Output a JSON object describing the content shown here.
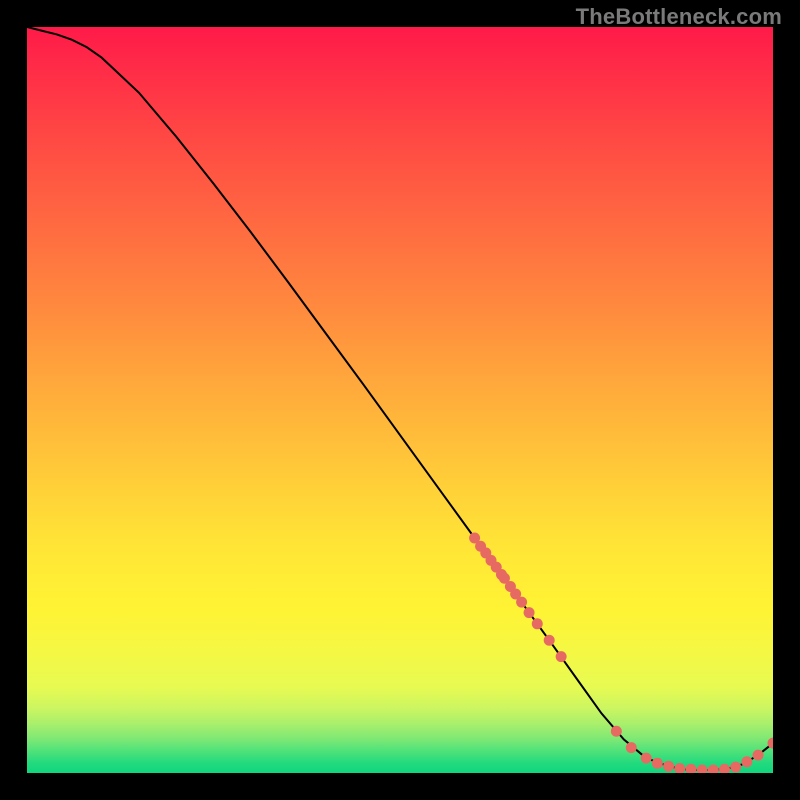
{
  "watermark": "TheBottleneck.com",
  "colors": {
    "gradient_top": "#ff1f4a",
    "gradient_mid": "#ffd93b",
    "gradient_bottom": "#15e27e",
    "line": "#000000",
    "marker": "#e76a62",
    "background": "#000000"
  },
  "chart_data": {
    "type": "line",
    "title": "",
    "xlabel": "",
    "ylabel": "",
    "xlim": [
      0,
      100
    ],
    "ylim": [
      0,
      100
    ],
    "grid": false,
    "legend": false,
    "series": [
      {
        "name": "curve",
        "x": [
          0,
          2,
          4,
          6,
          8,
          10,
          15,
          20,
          25,
          30,
          35,
          40,
          45,
          50,
          55,
          60,
          62,
          66,
          70,
          74,
          77,
          80,
          83,
          86,
          88,
          90,
          92,
          94,
          96,
          98,
          100
        ],
        "y": [
          100,
          99.5,
          99.0,
          98.3,
          97.3,
          95.9,
          91.2,
          85.3,
          79.0,
          72.5,
          65.8,
          59.0,
          52.2,
          45.3,
          38.4,
          31.5,
          28.8,
          23.3,
          17.8,
          12.2,
          8.0,
          4.5,
          2.0,
          0.9,
          0.5,
          0.4,
          0.4,
          0.6,
          1.2,
          2.4,
          4.0
        ]
      }
    ],
    "marker_clusters": [
      {
        "name": "upper-slope-cluster",
        "approx_x_range": [
          60,
          72
        ],
        "approx_y_range": [
          14,
          32
        ],
        "count": 14
      },
      {
        "name": "valley-cluster",
        "approx_x_range": [
          80,
          100
        ],
        "approx_y_range": [
          0,
          5
        ],
        "count": 14
      }
    ],
    "markers": [
      {
        "x": 60.0,
        "y": 31.5
      },
      {
        "x": 60.8,
        "y": 30.4
      },
      {
        "x": 61.5,
        "y": 29.5
      },
      {
        "x": 62.2,
        "y": 28.5
      },
      {
        "x": 62.9,
        "y": 27.6
      },
      {
        "x": 63.6,
        "y": 26.6
      },
      {
        "x": 64.0,
        "y": 26.1
      },
      {
        "x": 64.8,
        "y": 25.0
      },
      {
        "x": 65.5,
        "y": 24.0
      },
      {
        "x": 66.3,
        "y": 22.9
      },
      {
        "x": 67.3,
        "y": 21.5
      },
      {
        "x": 68.4,
        "y": 20.0
      },
      {
        "x": 70.0,
        "y": 17.8
      },
      {
        "x": 71.6,
        "y": 15.6
      },
      {
        "x": 79.0,
        "y": 5.6
      },
      {
        "x": 81.0,
        "y": 3.4
      },
      {
        "x": 83.0,
        "y": 2.0
      },
      {
        "x": 84.5,
        "y": 1.3
      },
      {
        "x": 86.0,
        "y": 0.9
      },
      {
        "x": 87.5,
        "y": 0.6
      },
      {
        "x": 89.0,
        "y": 0.5
      },
      {
        "x": 90.5,
        "y": 0.4
      },
      {
        "x": 92.0,
        "y": 0.4
      },
      {
        "x": 93.5,
        "y": 0.5
      },
      {
        "x": 95.0,
        "y": 0.8
      },
      {
        "x": 96.5,
        "y": 1.5
      },
      {
        "x": 98.0,
        "y": 2.4
      },
      {
        "x": 100.0,
        "y": 4.0
      }
    ]
  }
}
